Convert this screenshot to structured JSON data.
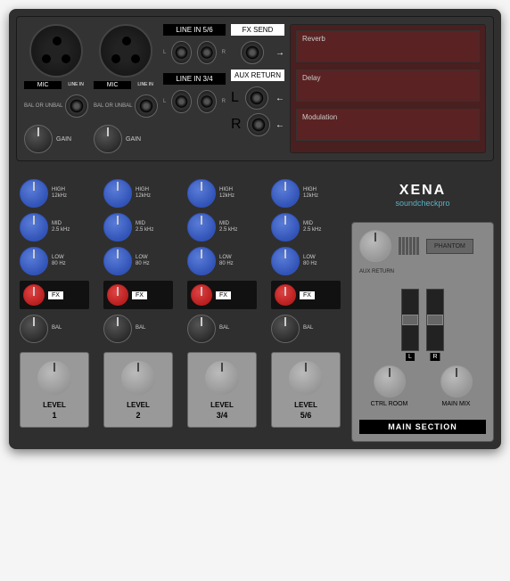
{
  "top": {
    "mic_label": "MIC",
    "line_in_label": "LINE IN",
    "bal_label": "BAL OR UNBAL",
    "gain_label": "GAIN",
    "line56": "LINE IN 5/6",
    "line34": "LINE IN 3/4",
    "fx_send": "FX SEND",
    "aux_return": "AUX RETURN",
    "L": "L",
    "R": "R"
  },
  "effects": {
    "reverb": "Reverb",
    "delay": "Delay",
    "modulation": "Modulation"
  },
  "eq": {
    "high": "HIGH",
    "high_freq": "12kHz",
    "mid": "MID",
    "mid_freq": "2.5 kHz",
    "low": "LOW",
    "low_freq": "80 Hz"
  },
  "fx_label": "FX",
  "bal_label": "BAL",
  "level_label": "LEVEL",
  "channels": [
    "1",
    "2",
    "3/4",
    "5/6"
  ],
  "brand": {
    "name": "XENA",
    "sub": "soundcheckpro"
  },
  "main": {
    "aux_return": "AUX RETURN",
    "phantom": "PHANTOM",
    "L": "L",
    "R": "R",
    "ctrl_room": "CTRL ROOM",
    "main_mix": "MAIN MIX",
    "section": "MAIN SECTION"
  }
}
